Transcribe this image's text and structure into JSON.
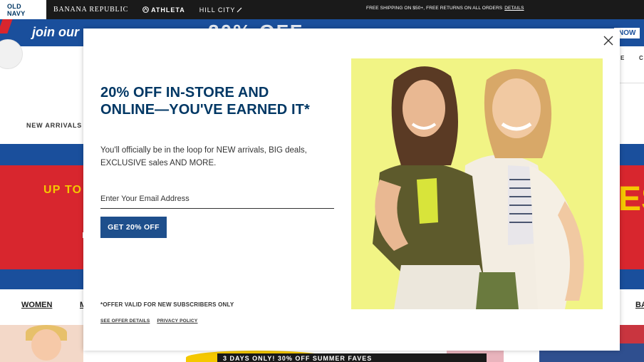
{
  "brand_bar": {
    "tabs": [
      {
        "label": "OLD NAVY",
        "active": true
      },
      {
        "label": "BANANA REPUBLIC",
        "active": false
      },
      {
        "label": "ATHLETA",
        "active": false,
        "icon": "athleta-logo-icon"
      },
      {
        "label": "HILL CITY",
        "active": false,
        "icon": "hill-city-mark-icon"
      }
    ],
    "shipping_message": "FREE SHIPPING ON $50+, FREE RETURNS ON ALL ORDERS",
    "shipping_link": "DETAILS"
  },
  "background_page": {
    "promo_banner": {
      "text_left": "join our",
      "text_mid": "20% OFF",
      "button": "NOW"
    },
    "header_nav_fragments": [
      "E",
      "C"
    ],
    "subnav_first": "NEW ARRIVALS",
    "sale_banner": {
      "upto": "UP TO",
      "tail": "ES"
    },
    "category_nav": {
      "women": "WOMEN",
      "men_fragment": "M",
      "right_fragment": "BA"
    },
    "bottom_bar_text": "3 DAYS ONLY! 30% OFF SUMMER FAVES"
  },
  "modal": {
    "title": "20% OFF IN-STORE AND ONLINE—YOU'VE EARNED IT*",
    "description": "You'll officially be in the loop for NEW arrivals, BIG deals, EXCLUSIVE sales AND MORE.",
    "email_placeholder": "Enter Your Email Address",
    "email_value": "",
    "cta_label": "GET 20% OFF",
    "fine_print": "*OFFER VALID FOR NEW SUBSCRIBERS ONLY",
    "links": {
      "offer_details": "SEE OFFER DETAILS",
      "privacy": "PRIVACY POLICY"
    },
    "close_icon": "close-icon",
    "hero_image": "two-women-smiling-photo"
  },
  "colors": {
    "navy_title": "#003764",
    "cta_blue": "#1e4f8c",
    "banner_blue": "#1a4f9c",
    "sale_red": "#d8262e",
    "sale_yellow": "#f5c800",
    "hero_background": "#eef27a"
  }
}
